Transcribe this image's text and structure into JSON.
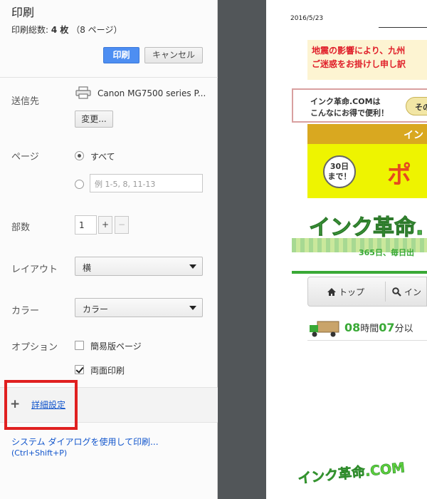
{
  "dialog": {
    "title": "印刷",
    "total_label": "印刷総数:",
    "total_value": "4 枚",
    "total_pages": "（8 ページ）",
    "print_button": "印刷",
    "cancel_button": "キャンセル"
  },
  "destination": {
    "label": "送信先",
    "printer_name": "Canon MG7500 series P...",
    "change_button": "変更..."
  },
  "pages": {
    "label": "ページ",
    "all_label": "すべて",
    "range_placeholder": "例 1-5, 8, 11-13",
    "selected": "all"
  },
  "copies": {
    "label": "部数",
    "value": "1",
    "plus": "+",
    "minus": "−"
  },
  "layout": {
    "label": "レイアウト",
    "value": "横"
  },
  "color": {
    "label": "カラー",
    "value": "カラー"
  },
  "options": {
    "label": "オプション",
    "simplified_label": "簡易版ページ",
    "simplified_checked": false,
    "duplex_label": "両面印刷",
    "duplex_checked": true
  },
  "advanced": {
    "plus": "+",
    "link": "詳細設定"
  },
  "system_dialog": {
    "link": "システム ダイアログを使用して印刷...",
    "shortcut": "(Ctrl+Shift+P)"
  },
  "preview": {
    "date": "2016/5/23",
    "notice_line1": "地震の影響により、九州",
    "notice_line2": "ご迷惑をお掛けし申し訳",
    "promo_line1": "インク革命.COMは",
    "promo_line2": "こんなにお得で便利！",
    "promo_pill": "その",
    "banner_top": "イン",
    "badge_line1": "30日",
    "badge_line2": "まで！",
    "banner_big": "ポ",
    "logo": "インク革命.",
    "tagline": "365日、毎日出",
    "nav_top": "トップ",
    "nav_ink": "イン",
    "delivery_hours": "08",
    "delivery_hours_unit": "時間",
    "delivery_minutes": "07",
    "delivery_minutes_unit": "分以",
    "footer_logo": "インク革命.COM"
  },
  "colors": {
    "print_button": "#4d8ef2",
    "link": "#1155cc",
    "highlight_box": "#e02020",
    "preview_bg": "#525659"
  }
}
